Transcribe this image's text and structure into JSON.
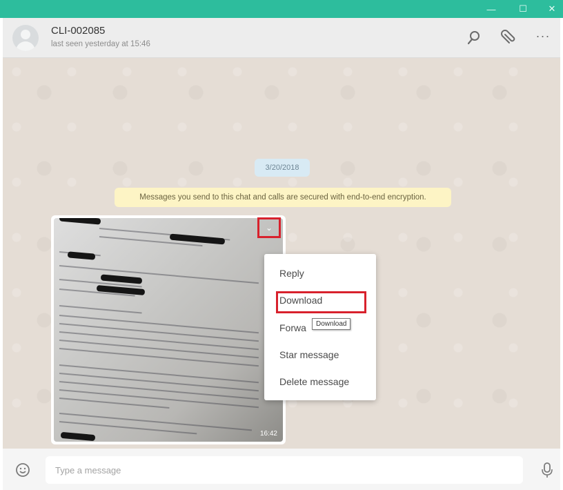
{
  "window": {
    "minimize": "—",
    "maximize": "☐",
    "close": "✕"
  },
  "header": {
    "contact_name": "CLI-002085",
    "last_seen": "last seen yesterday at 15:46",
    "menu_glyph": "···"
  },
  "chat": {
    "date_chip": "3/20/2018",
    "encryption_notice": "Messages you send to this chat and calls are secured with end-to-end encryption.",
    "image_message": {
      "time": "16:42",
      "chevron": "⌄"
    }
  },
  "context_menu": {
    "items": [
      "Reply",
      "Download",
      "Forward message",
      "Star message",
      "Delete message"
    ],
    "forward_visible": "Forwa",
    "tooltip": "Download"
  },
  "composer": {
    "placeholder": "Type a message"
  },
  "colors": {
    "accent": "#2dbd9d",
    "highlight": "#d8212c",
    "chat_bg": "#e5ddd5",
    "notice_bg": "#fdf4c5",
    "date_bg": "#d8eaf4"
  },
  "icons": [
    "avatar",
    "search-icon",
    "paperclip-icon",
    "menu-icon",
    "chevron-down-icon",
    "emoji-icon",
    "microphone-icon"
  ]
}
